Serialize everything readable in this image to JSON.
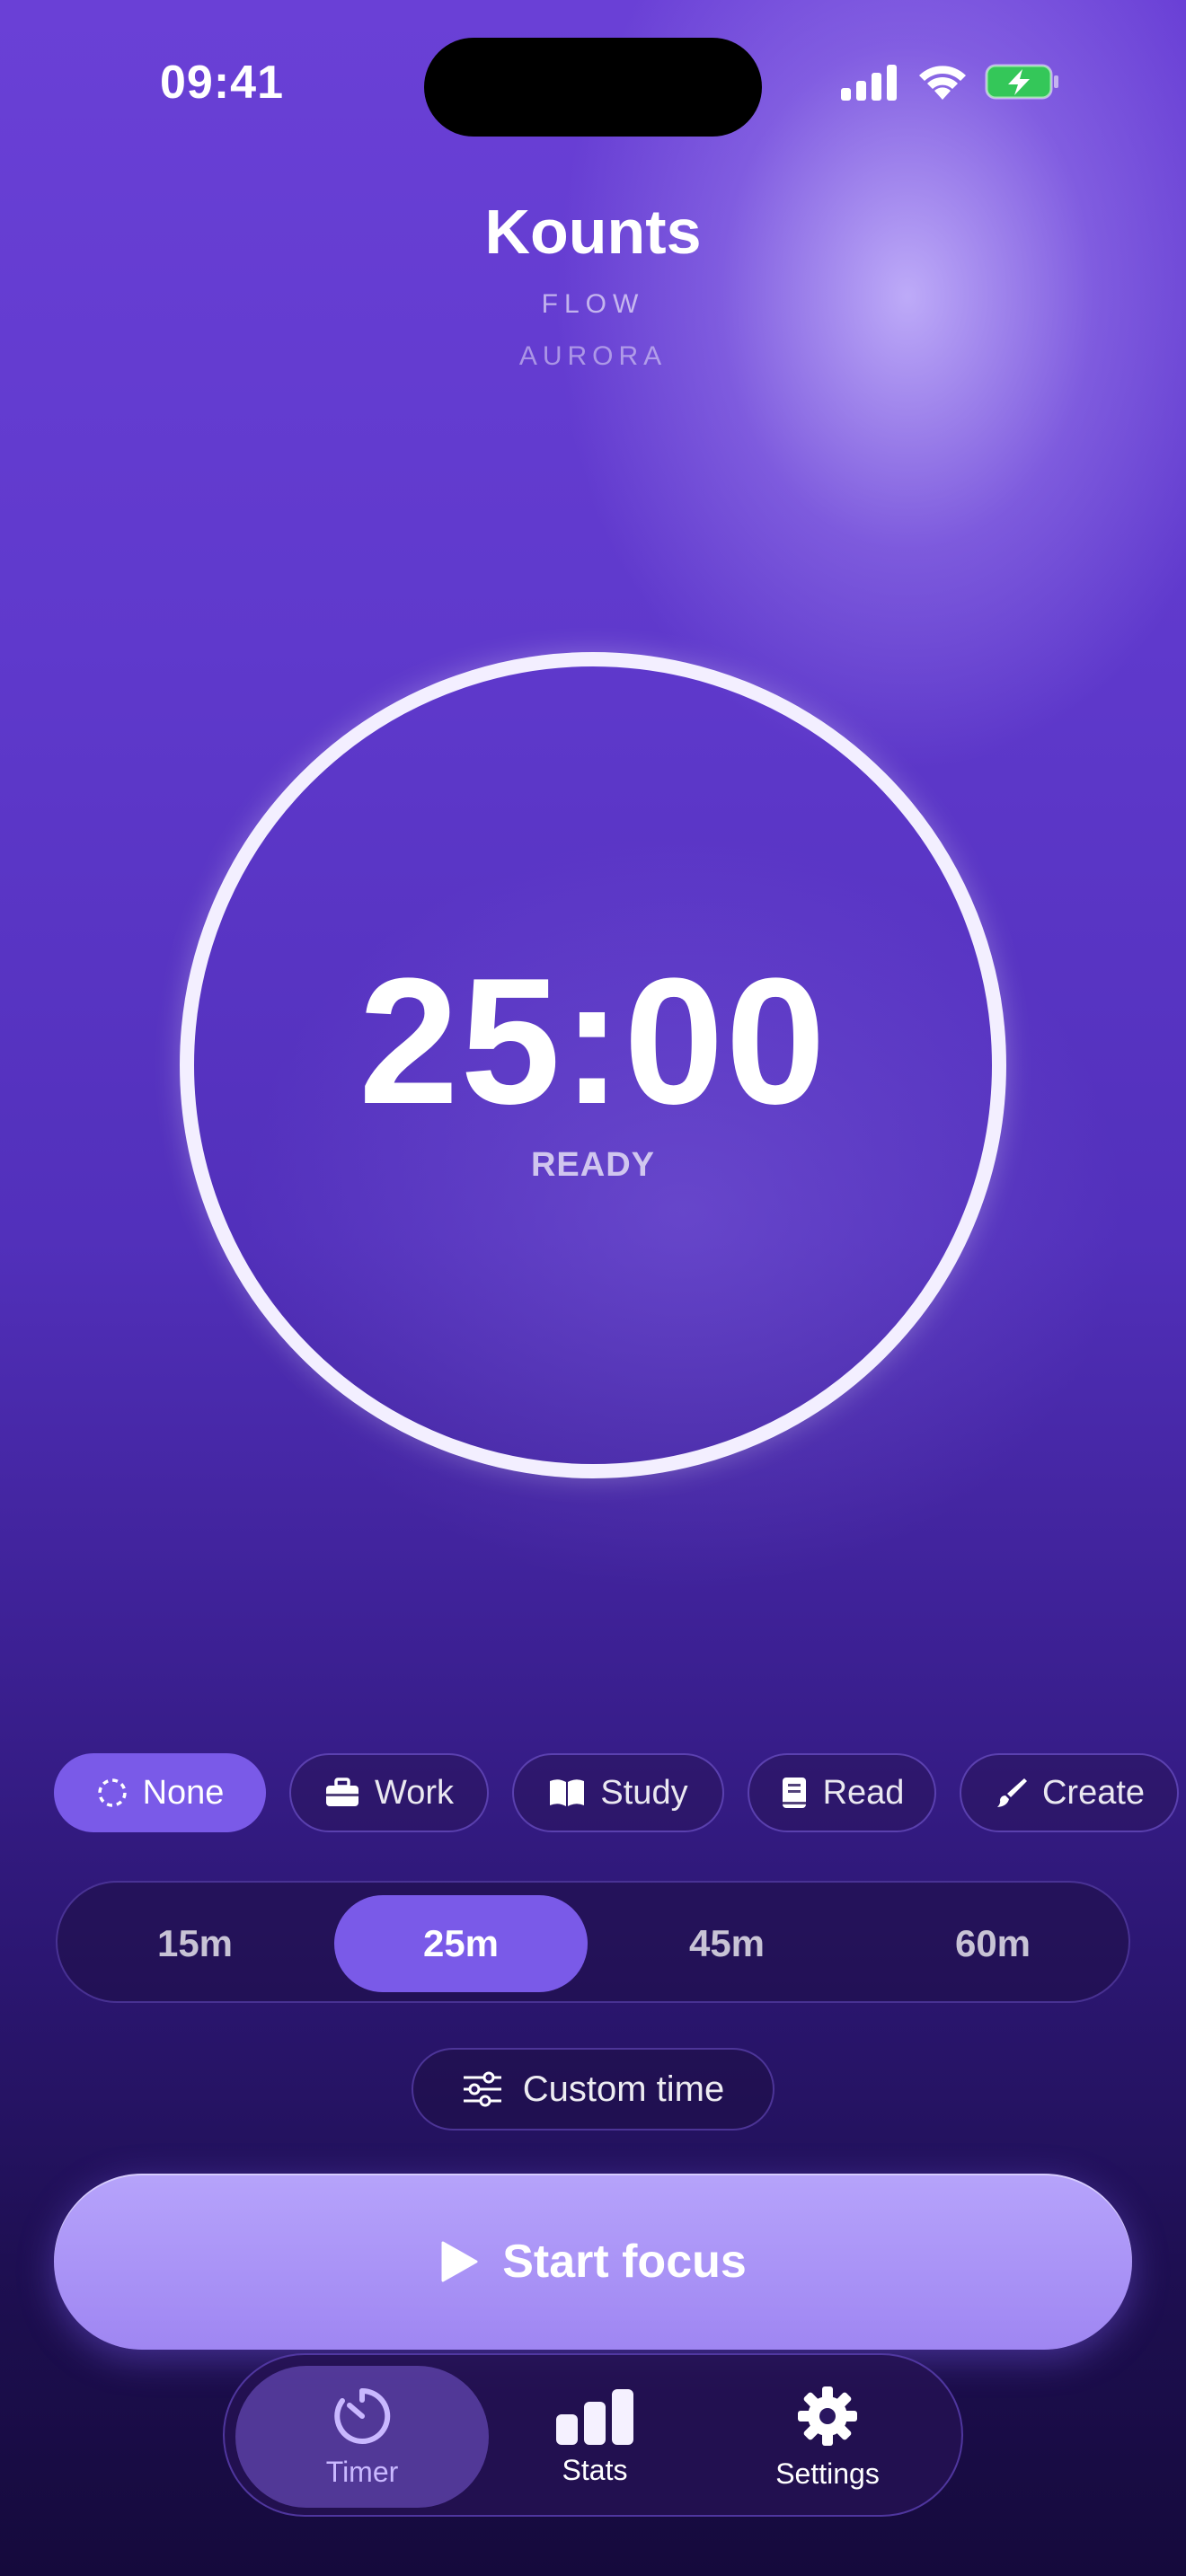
{
  "status_bar": {
    "time": "09:41",
    "icons": [
      "cellular-signal-icon",
      "wifi-icon",
      "battery-charging-icon"
    ]
  },
  "header": {
    "title": "Kounts",
    "subtitle": "FLOW",
    "theme": "AURORA"
  },
  "timer": {
    "display": "25:00",
    "status": "READY",
    "ring_progress": 1.0
  },
  "categories": [
    {
      "label": "None",
      "icon": "dashed-circle-icon",
      "selected": true
    },
    {
      "label": "Work",
      "icon": "briefcase-icon",
      "selected": false
    },
    {
      "label": "Study",
      "icon": "open-book-icon",
      "selected": false
    },
    {
      "label": "Read",
      "icon": "book-icon",
      "selected": false
    },
    {
      "label": "Create",
      "icon": "paintbrush-icon",
      "selected": false
    }
  ],
  "durations": [
    {
      "label": "15m",
      "selected": false
    },
    {
      "label": "25m",
      "selected": true
    },
    {
      "label": "45m",
      "selected": false
    },
    {
      "label": "60m",
      "selected": false
    }
  ],
  "custom_time": {
    "label": "Custom time",
    "icon": "sliders-icon"
  },
  "start_button": {
    "label": "Start focus",
    "icon": "play-icon"
  },
  "tabbar": {
    "items": [
      {
        "label": "Timer",
        "icon": "timer-icon",
        "active": true
      },
      {
        "label": "Stats",
        "icon": "bar-chart-icon",
        "active": false
      },
      {
        "label": "Settings",
        "icon": "gear-icon",
        "active": false
      }
    ]
  },
  "colors": {
    "accent": "#7a5ae8",
    "start_button": "#a68cf4",
    "battery": "#34c759",
    "background_top": "#6a40d6",
    "background_bottom": "#150a3c"
  }
}
